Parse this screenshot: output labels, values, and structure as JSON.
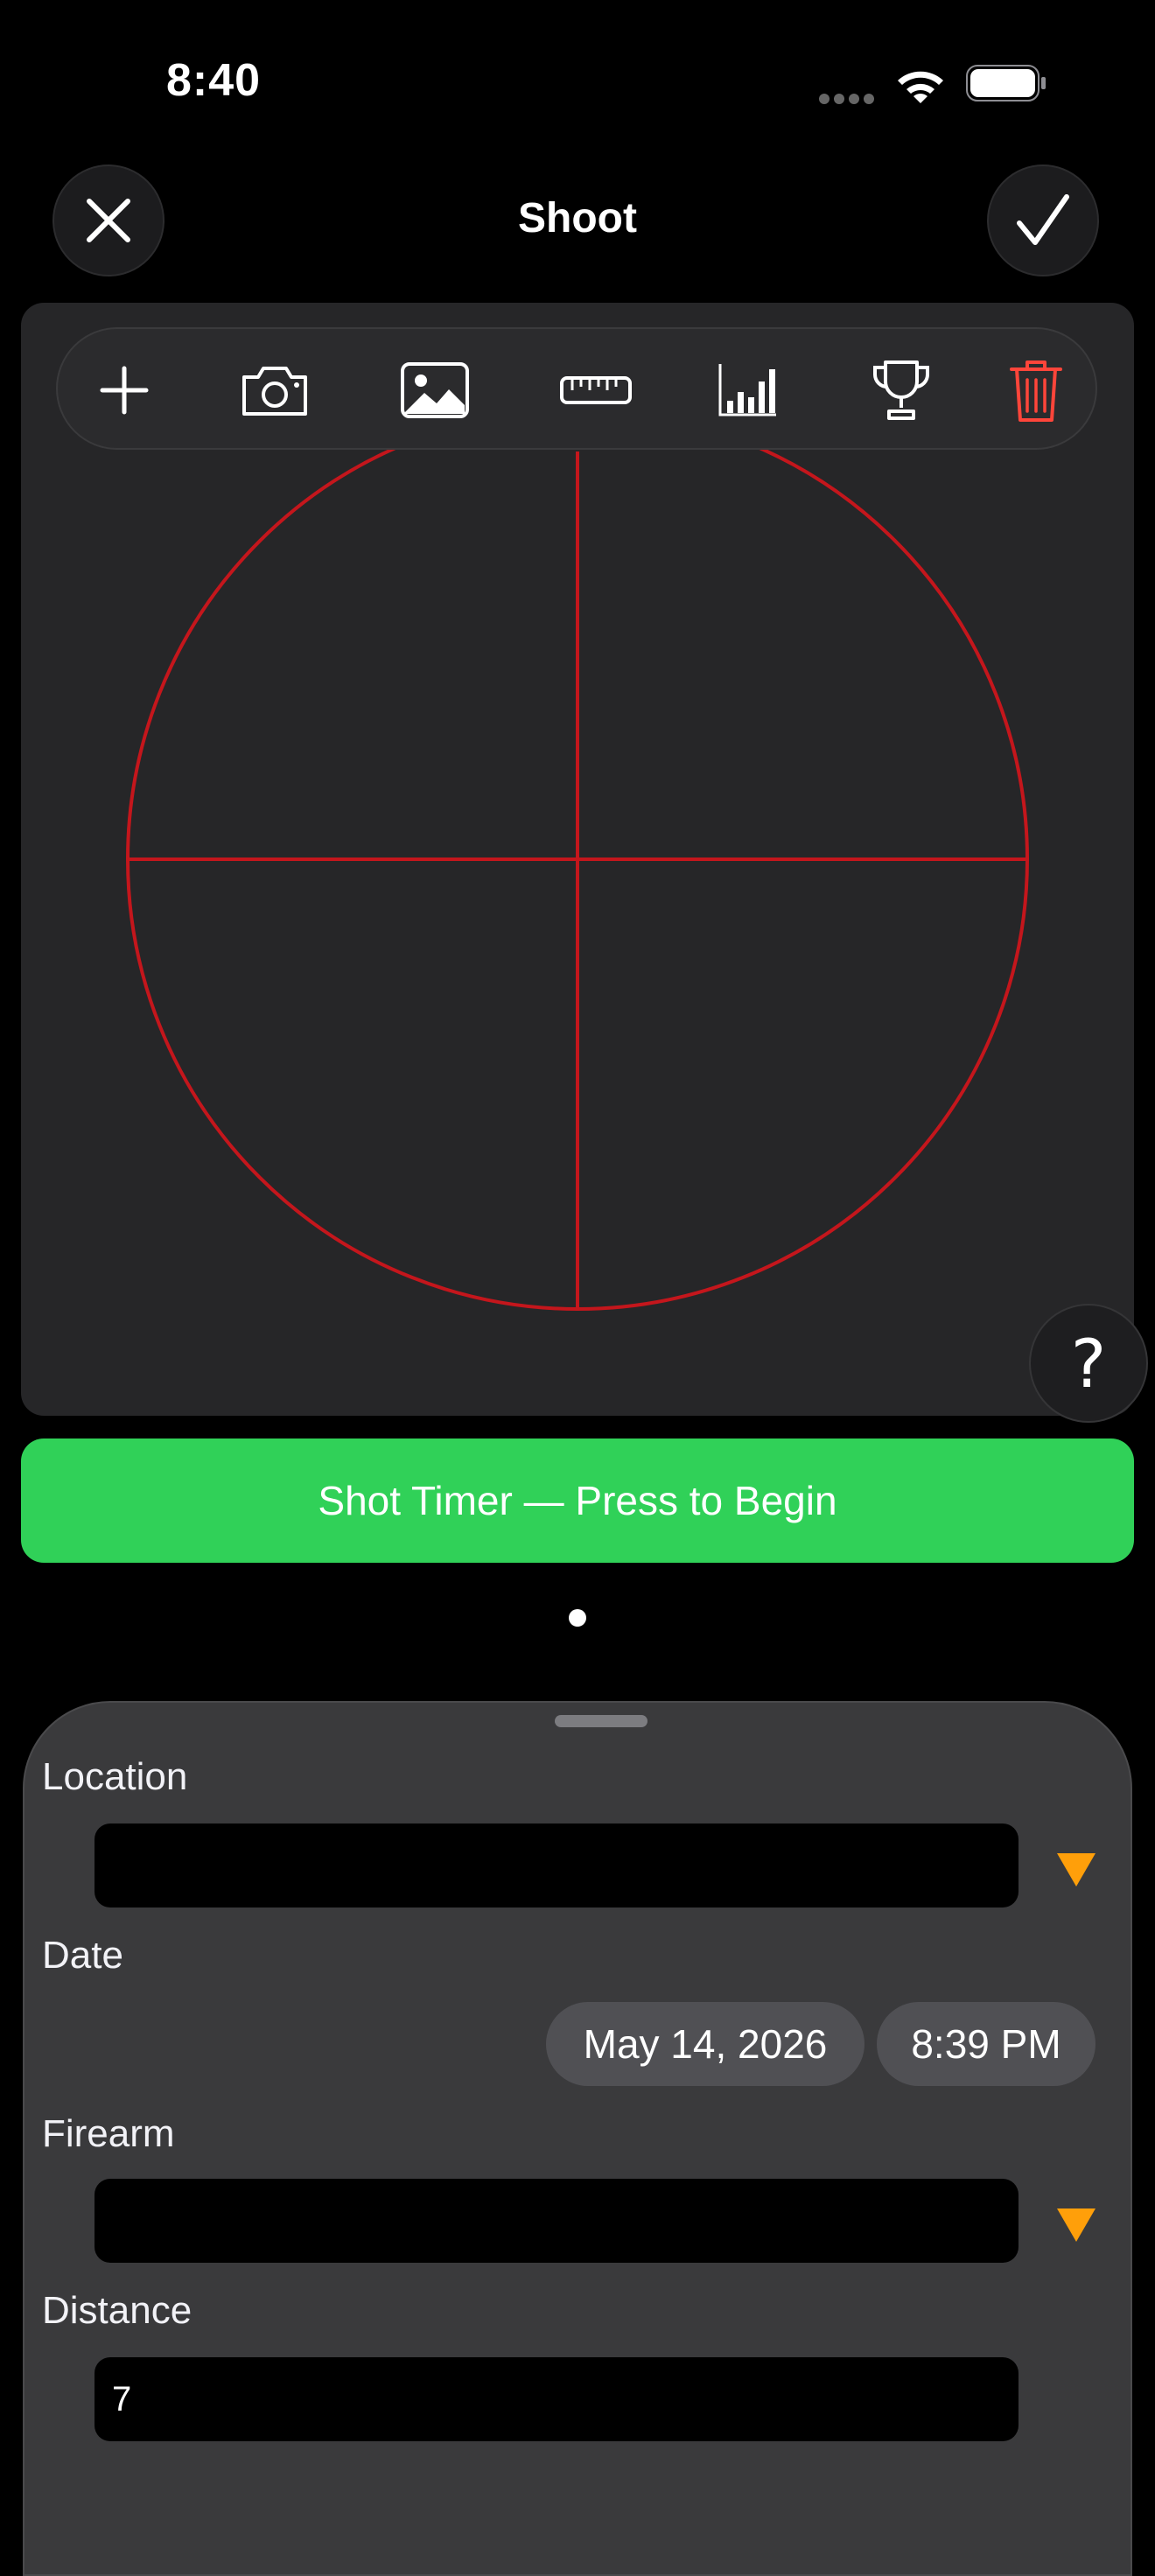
{
  "status": {
    "time": "8:40"
  },
  "nav": {
    "title": "Shoot"
  },
  "toolbar": {
    "items": [
      "add-icon",
      "camera-icon",
      "photo-icon",
      "ruler-icon",
      "chart-icon",
      "trophy-icon",
      "trash-icon"
    ],
    "trash_color": "#ff453a"
  },
  "target": {
    "reticle_color": "#c4161c"
  },
  "help": {
    "label": "?"
  },
  "timer": {
    "label": "Shot Timer — Press to Begin",
    "color": "#30d158"
  },
  "form": {
    "location": {
      "label": "Location",
      "value": ""
    },
    "date": {
      "label": "Date",
      "date_value": "May 14, 2026",
      "time_value": "8:39 PM"
    },
    "firearm": {
      "label": "Firearm",
      "value": ""
    },
    "distance": {
      "label": "Distance",
      "value": "7"
    },
    "accent": "#ff9f0a"
  }
}
